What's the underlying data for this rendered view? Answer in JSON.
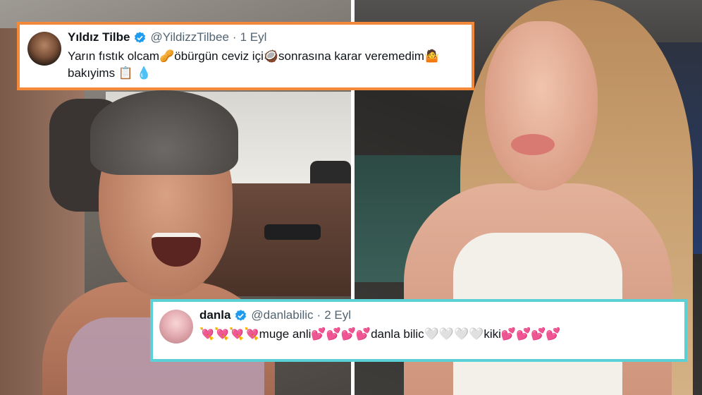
{
  "tweets": {
    "top": {
      "author": "Yıldız Tilbe",
      "handle": "@YildizzTilbee",
      "separator": "·",
      "date": "1 Eyl",
      "line1_a": "Yarın fıstık olcam",
      "emoji_peanut": "🥜",
      "line1_b": "öbürgün ceviz içi",
      "emoji_coconut": "🥥",
      "line1_c": "sonrasına karar veremedim",
      "emoji_person": "🤷",
      "line2_a": "bakıyims",
      "emoji_clipboard": "📋",
      "emoji_droplet": "💧",
      "border_color": "#f5893a"
    },
    "bottom": {
      "author": "danla",
      "handle": "@danlabilic",
      "separator": "·",
      "date": "2 Eyl",
      "hearts_arrow": "💘💘💘💘",
      "text_a": "muge anli",
      "hearts_red_1": "💕💕💕💕",
      "text_b": "danla bilic",
      "hearts_white": "🤍🤍🤍🤍",
      "text_c": "kiki",
      "hearts_red_2": "💕💕💕💕",
      "border_color": "#5bd0d6"
    }
  },
  "icons": {
    "verified": "verified-badge-icon"
  },
  "colors": {
    "verified_blue": "#1d9bf0",
    "text": "#0f1419",
    "muted": "#536471"
  }
}
